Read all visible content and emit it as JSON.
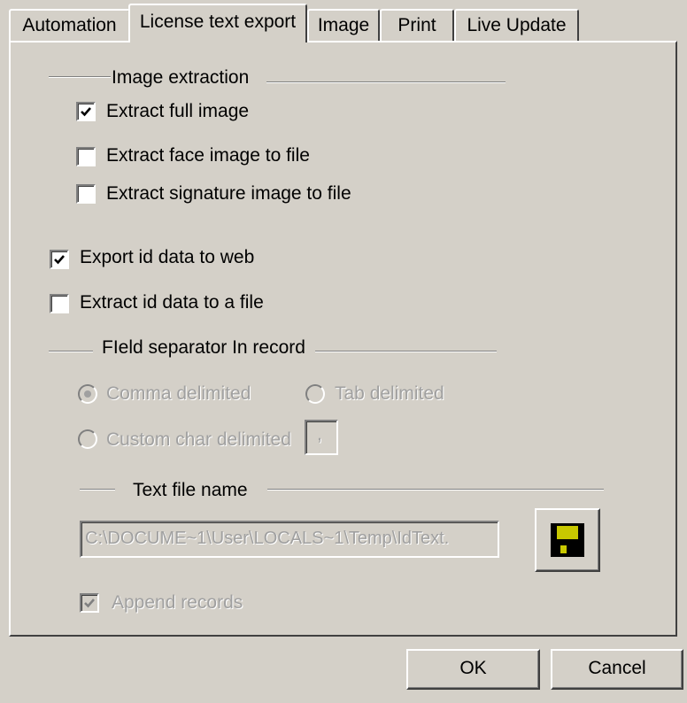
{
  "tabs": [
    {
      "label": "Automation"
    },
    {
      "label": "License text export"
    },
    {
      "label": "Image"
    },
    {
      "label": "Print"
    },
    {
      "label": "Live Update"
    }
  ],
  "active_tab": "License text export",
  "image_extraction": {
    "title": "Image extraction",
    "extract_full_image": {
      "label": "Extract full image",
      "checked": true
    },
    "extract_face_image": {
      "label": "Extract face image to file",
      "checked": false
    },
    "extract_signature_image": {
      "label": "Extract signature image to file",
      "checked": false
    }
  },
  "export_id_web": {
    "label": "Export id data to web",
    "checked": true
  },
  "extract_id_file": {
    "label": "Extract id data to a file",
    "checked": false
  },
  "field_separator": {
    "title": "FIeld separator In record",
    "comma": {
      "label": "Comma delimited",
      "selected": true,
      "enabled": false
    },
    "tab": {
      "label": "Tab delimited",
      "selected": false,
      "enabled": false
    },
    "custom": {
      "label": "Custom char delimited",
      "selected": false,
      "enabled": false
    },
    "custom_char_value": ","
  },
  "text_file": {
    "title": "Text file name",
    "path_value": "C:\\DOCUME~1\\User\\LOCALS~1\\Temp\\IdText.",
    "save_icon": "floppy-disk-icon",
    "append_records": {
      "label": "Append records",
      "checked": true,
      "enabled": false
    }
  },
  "buttons": {
    "ok": "OK",
    "cancel": "Cancel"
  },
  "colors": {
    "face": "#d4d0c8",
    "disabled_text": "#a0a0a0",
    "floppy_yellow": "#c8c800"
  }
}
